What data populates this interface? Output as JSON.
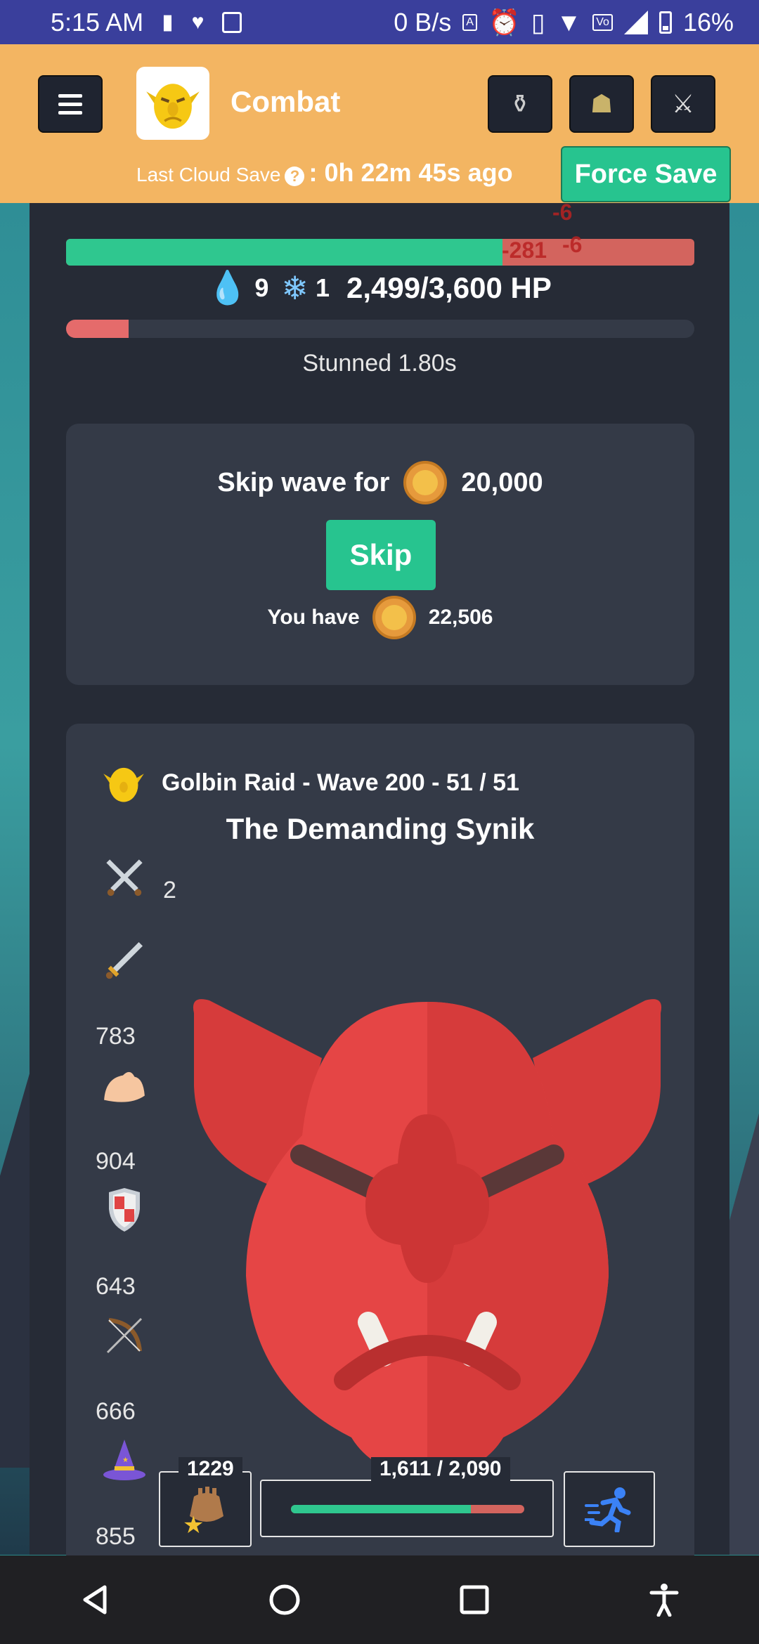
{
  "status_bar": {
    "time": "5:15 AM",
    "net_speed": "0 B/s",
    "battery": "16%",
    "icons": [
      "battery-saver-icon",
      "health-icon",
      "gallery-icon",
      "auto-icon",
      "alarm-icon",
      "vibrate-icon",
      "wifi-icon",
      "volte-icon",
      "signal-icon",
      "battery-icon"
    ]
  },
  "header": {
    "title": "Combat",
    "last_save_label": "Last Cloud Save",
    "last_save_time": ": 0h 22m 45s ago",
    "force_save": "Force Save",
    "icons": [
      "menu-icon",
      "potion-icon",
      "goblin-mask-icon",
      "crossed-swords-icon"
    ]
  },
  "player": {
    "hp_text": "2,499/3,600 HP",
    "hp_current": 2499,
    "hp_max": 3600,
    "bleed_count": "9",
    "frost_count": "1",
    "stun_text": "Stunned 1.80s",
    "stun_fraction": 0.1,
    "damage_floats": [
      "-6",
      "-281",
      "-6"
    ]
  },
  "skip_wave": {
    "label": "Skip wave for",
    "cost": "20,000",
    "button": "Skip",
    "have_label": "You have",
    "have_amount": "22,506"
  },
  "enemy": {
    "raid_text": "Golbin Raid - Wave 200 - 51 / 51",
    "name": "The Demanding Synik",
    "stats": [
      {
        "icon": "crossed-swords-icon",
        "value": "2"
      },
      {
        "icon": "sword-icon",
        "value": "783"
      },
      {
        "icon": "strength-arm-icon",
        "value": "904"
      },
      {
        "icon": "shield-icon",
        "value": "643"
      },
      {
        "icon": "bow-icon",
        "value": "666"
      },
      {
        "icon": "wizard-hat-icon",
        "value": "855"
      }
    ]
  },
  "bottom_bar": {
    "food_count": "1229",
    "enemy_hp_text": "1,611 / 2,090",
    "enemy_hp_current": 1611,
    "enemy_hp_max": 2090
  },
  "colors": {
    "header": "#f3b562",
    "panel": "#262b36",
    "card": "#343a47",
    "accent_green": "#27c48f",
    "hp_red": "#d3645e",
    "goblin_red": "#e04343"
  }
}
